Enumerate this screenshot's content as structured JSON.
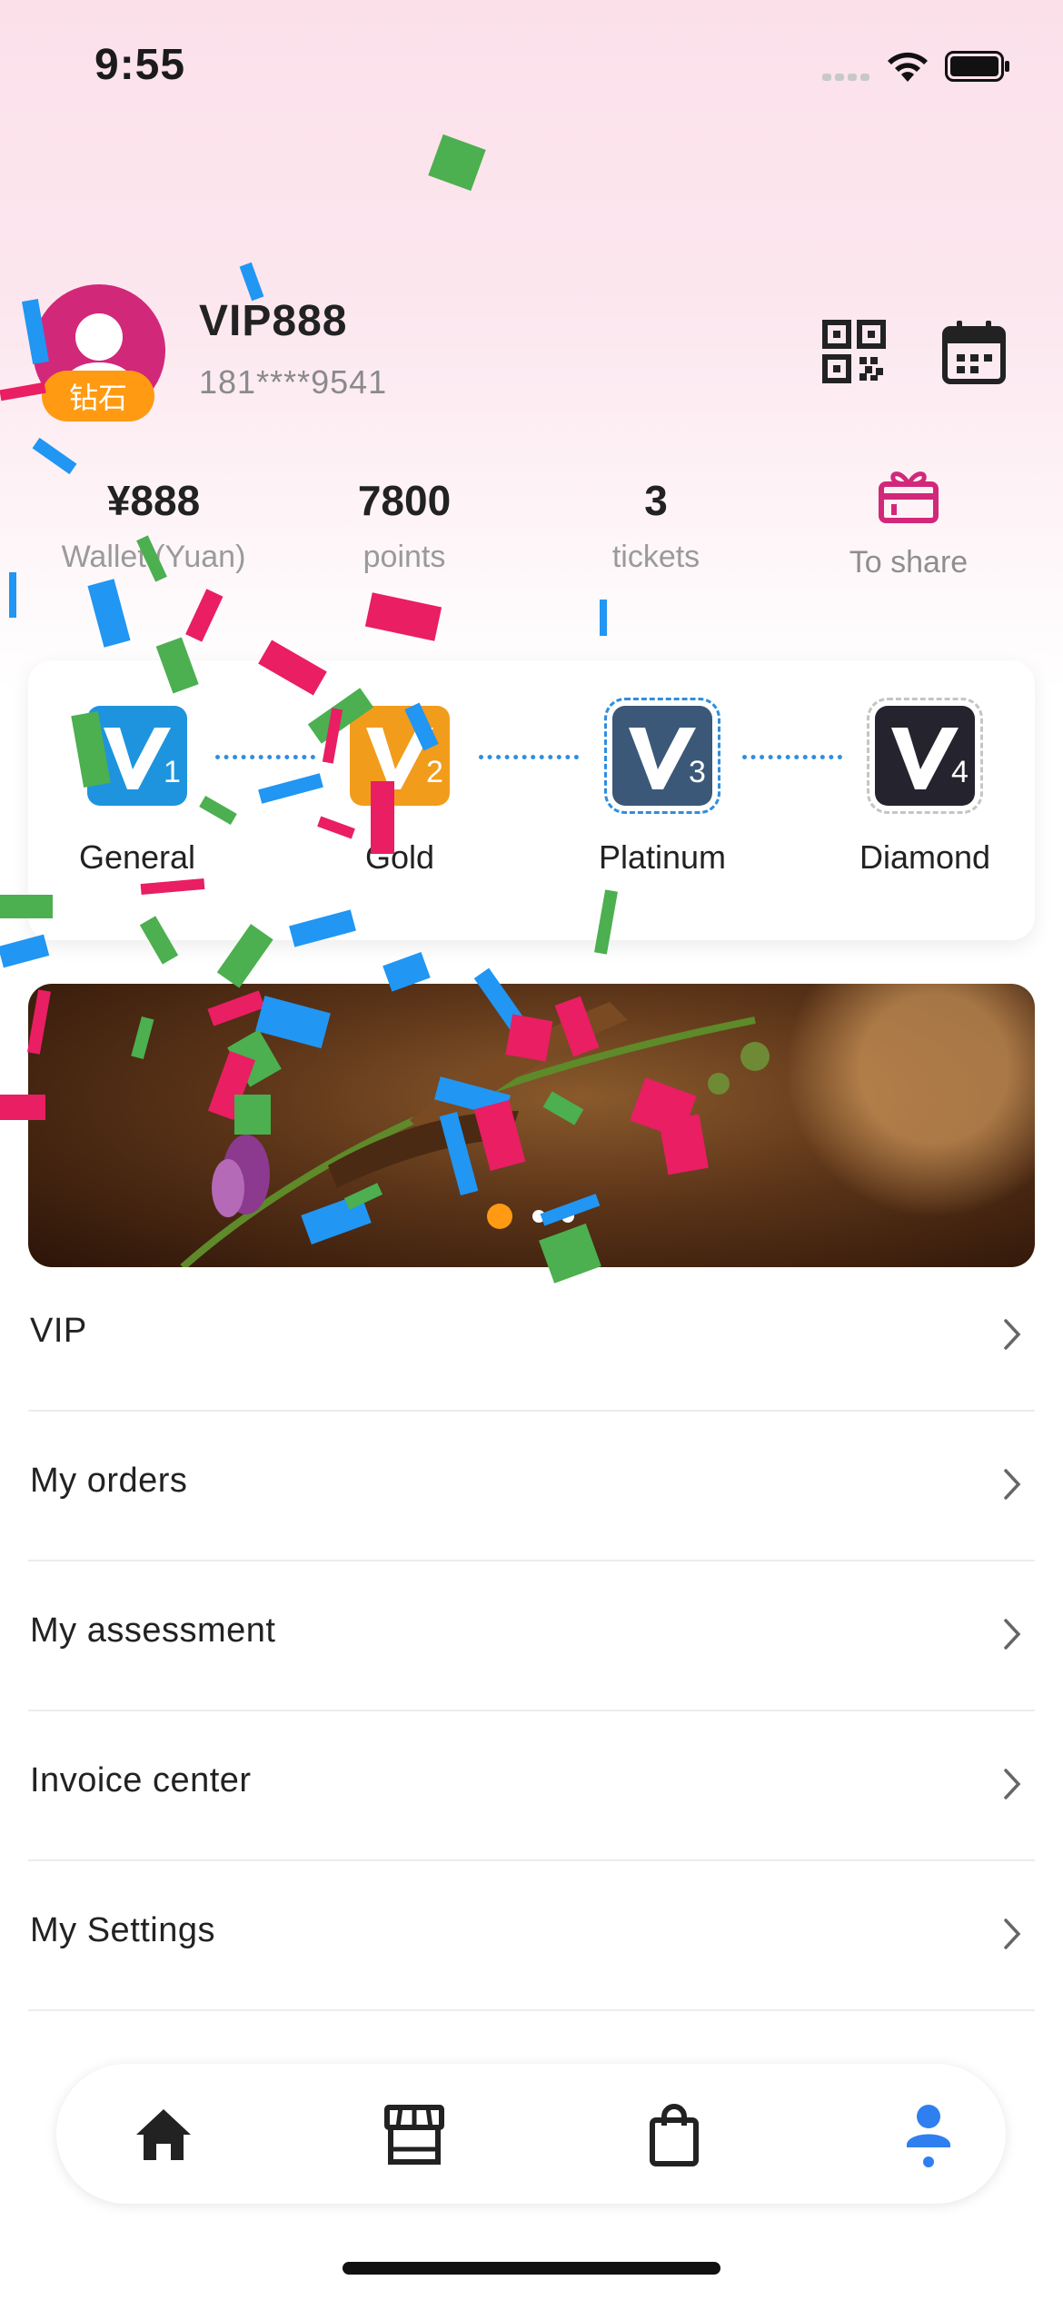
{
  "status_bar": {
    "time": "9:55"
  },
  "profile": {
    "name": "VIP888",
    "phone": "181****9541",
    "level_badge": "钻石"
  },
  "stats": [
    {
      "value": "¥888",
      "label": "Wallet (Yuan)"
    },
    {
      "value": "7800",
      "label": "points"
    },
    {
      "value": "3",
      "label": "tickets"
    }
  ],
  "share": {
    "label": "To share"
  },
  "levels": [
    {
      "name": "General",
      "mark": "V",
      "num": "1",
      "color": "#1e94de"
    },
    {
      "name": "Gold",
      "mark": "V",
      "num": "2",
      "color": "#f29c1c"
    },
    {
      "name": "Platinum",
      "mark": "V",
      "num": "3",
      "color": "#3b5878"
    },
    {
      "name": "Diamond",
      "mark": "V",
      "num": "4",
      "color": "#25232e"
    }
  ],
  "banner": {
    "active_index": 0,
    "dots": 3
  },
  "menu": [
    {
      "label": "VIP"
    },
    {
      "label": "My orders"
    },
    {
      "label": "My assessment"
    },
    {
      "label": "Invoice center"
    },
    {
      "label": "My Settings"
    }
  ],
  "bottom_nav": {
    "items": [
      "home-icon",
      "store-icon",
      "shopping-bag-icon",
      "person-icon"
    ],
    "active_index": 3,
    "active_color": "#2f7ff0",
    "inactive_color": "#222222"
  },
  "colors": {
    "accent_pink": "#d2287a",
    "badge_orange": "#ff9a12",
    "confetti": [
      "#4caf50",
      "#2196f3",
      "#e91e63"
    ]
  }
}
